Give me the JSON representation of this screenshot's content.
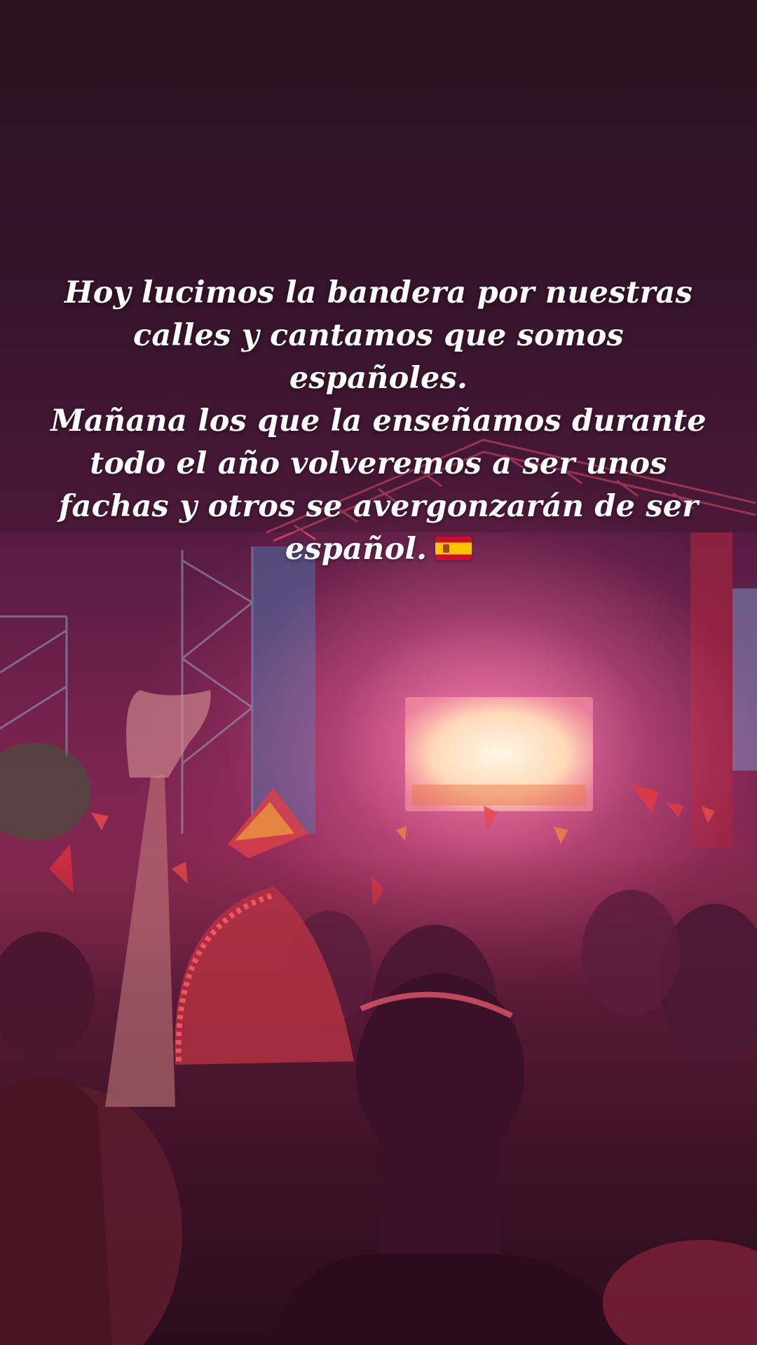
{
  "story": {
    "caption_lines": [
      "Hoy lucimos la bandera por nuestras",
      "calles y cantamos que somos",
      "españoles.",
      "Mañana los que la enseñamos durante",
      "todo el año volveremos a ser unos",
      "fachas y otros se avergonzarán de ser",
      "español."
    ],
    "emoji": "spain-flag-icon"
  },
  "colors": {
    "background_top": "#2b1222",
    "stage_light": "#ff9ec4",
    "screen_glow": "#ffe9c9",
    "caption_text": "#ffffff",
    "flag_red": "#c8102e",
    "flag_yellow": "#ffc400"
  }
}
